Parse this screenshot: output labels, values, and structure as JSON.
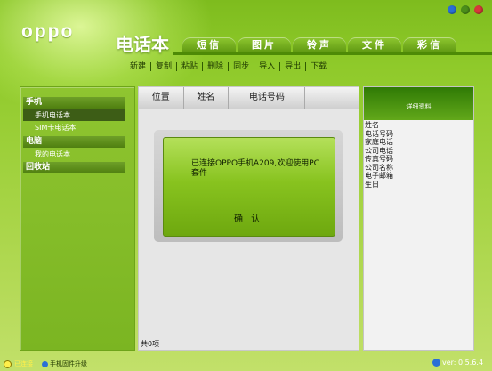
{
  "app": {
    "brand": "oppo",
    "page_title": "电话本"
  },
  "window_controls": [
    {
      "name": "bluetooth-icon",
      "color": "#2a6fd6"
    },
    {
      "name": "minimize-icon",
      "color": "#4b8e1a"
    },
    {
      "name": "close-icon",
      "color": "#d63a3a"
    }
  ],
  "tabs": [
    "短信",
    "图片",
    "铃声",
    "文件",
    "彩信"
  ],
  "toolbar": [
    "新建",
    "复制",
    "粘贴",
    "删除",
    "同步",
    "导入",
    "导出",
    "下载"
  ],
  "sidebar": {
    "phone_section": "手机",
    "phone_items": [
      "手机电话本",
      "SIM卡电话本"
    ],
    "pc_section": "电脑",
    "pc_items": [
      "我的电话本"
    ],
    "recycle_section": "回收站"
  },
  "table": {
    "columns": [
      "位置",
      "姓名",
      "电话号码"
    ]
  },
  "dialog": {
    "message": "已连接OPPO手机A209,欢迎使用PC套件",
    "ok_label": "确 认"
  },
  "count_text": "共0项",
  "details": {
    "title": "详细资料",
    "fields": [
      "姓名",
      "电话号码",
      "家庭电话",
      "公司电话",
      "传真号码",
      "公司名称",
      "电子邮箱",
      "生日"
    ]
  },
  "footer": {
    "status": "已连接",
    "upgrade": "手机固件升级",
    "version": "ver: 0.5.6.4"
  },
  "colors": {
    "accent": "#7ebc1e",
    "dark_green": "#3d5d16",
    "status_yellow": "#ffef4a"
  }
}
